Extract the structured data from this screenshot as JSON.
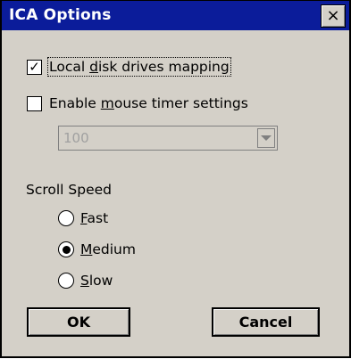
{
  "window": {
    "title": "ICA Options",
    "close_symbol": "×"
  },
  "options": {
    "local_disk": {
      "checked": true,
      "check_mark": "✓",
      "label_pre": "Local ",
      "label_mnemonic": "d",
      "label_post": "isk drives mapping"
    },
    "mouse_timer": {
      "checked": false,
      "label_pre": "Enable ",
      "label_mnemonic": "m",
      "label_post": "ouse timer settings"
    },
    "timer_combo": {
      "value": "100",
      "disabled": true
    }
  },
  "scroll_speed": {
    "label": "Scroll Speed",
    "selected": "Medium",
    "options": [
      {
        "mnemonic": "F",
        "rest": "ast"
      },
      {
        "mnemonic": "M",
        "rest": "edium"
      },
      {
        "mnemonic": "S",
        "rest": "low"
      }
    ]
  },
  "buttons": {
    "ok": "OK",
    "cancel": "Cancel"
  }
}
